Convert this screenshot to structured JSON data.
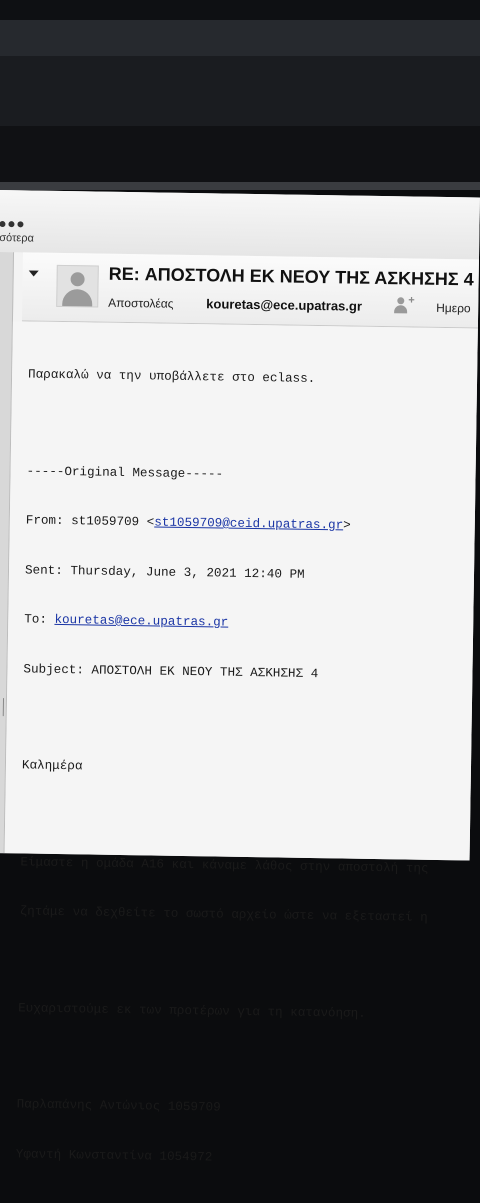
{
  "toolbar": {
    "nav_label": "σότερα"
  },
  "email": {
    "subject": "RE: ΑΠΟΣΤΟΛΗ ΕΚ ΝΕΟΥ ΤΗΣ ΑΣΚΗΣΗΣ 4",
    "from_label": "Αποστολέας",
    "from_value": "kouretas@ece.upatras.gr",
    "date_label": "Ημερο"
  },
  "body": {
    "line1": "Παρακαλώ να την υποβάλλετε στο eclass.",
    "original_header": "-----Original Message-----",
    "from_prefix": "From: st1059709 <",
    "from_email": "st1059709@ceid.upatras.gr",
    "from_suffix": ">",
    "sent": "Sent: Thursday, June 3, 2021 12:40 PM",
    "to_prefix": "To: ",
    "to_email": "kouretas@ece.upatras.gr",
    "subject_line": "Subject: ΑΠΟΣΤΟΛΗ ΕΚ ΝΕΟΥ ΤΗΣ ΑΣΚΗΣΗΣ 4",
    "greeting": "Καλημέρα",
    "para1_a": "Είμαστε η ομάδα Α16 και κάναμε λάθος στην αποστολή της",
    "para1_b": "ζητάμε να δεχθείτε το σωστό αρχείο ώστε να εξεταστεί η",
    "thanks": "Ευχαριστούμε εκ των προτέρων για τη κατανόηση.",
    "sig1": "Παρλαπάνης Αντώνιος 1059709",
    "sig2": "Υφαντή Κωνσταντίνα 1054972"
  }
}
